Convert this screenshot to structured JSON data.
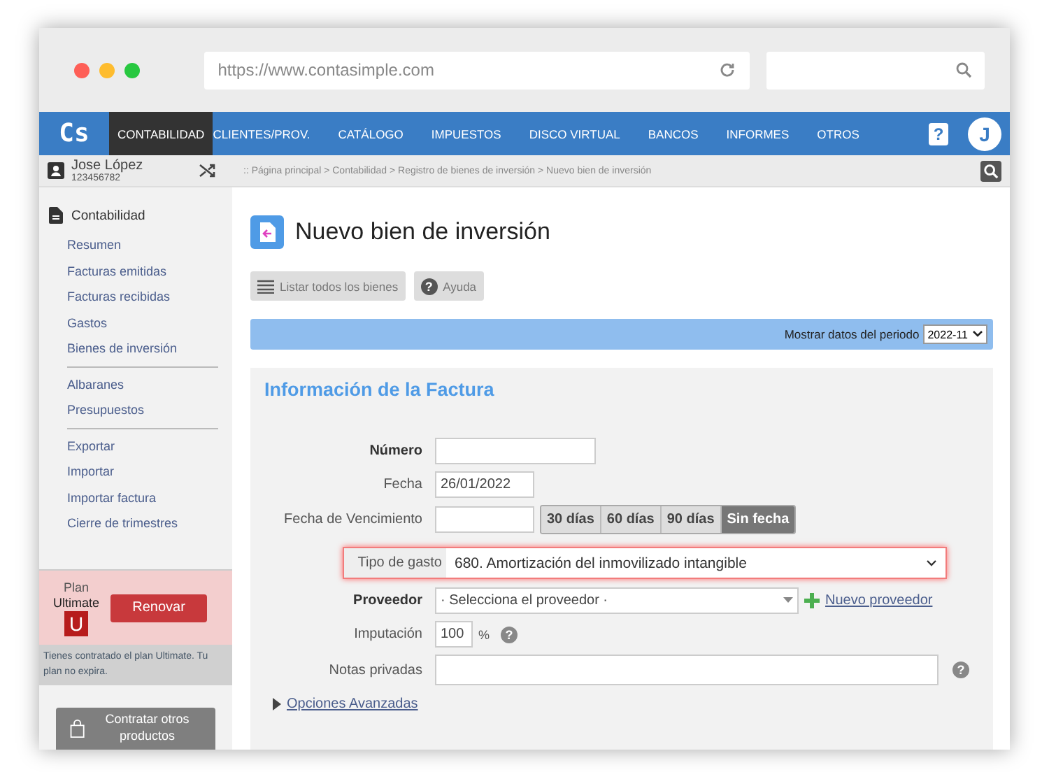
{
  "browser": {
    "url": "https://www.contasimple.com"
  },
  "nav": {
    "logo": "Cs",
    "items": [
      {
        "label": "CONTABILIDAD",
        "selected": true
      },
      {
        "label": "CLIENTES/PROV.",
        "selected": false
      },
      {
        "label": "CATÁLOGO",
        "selected": false
      },
      {
        "label": "IMPUESTOS",
        "selected": false
      },
      {
        "label": "DISCO VIRTUAL",
        "selected": false
      },
      {
        "label": "BANCOS",
        "selected": false
      },
      {
        "label": "INFORMES",
        "selected": false
      },
      {
        "label": "OTROS",
        "selected": false
      }
    ],
    "help": "?",
    "avatar": "J"
  },
  "user": {
    "name": "Jose López",
    "id": "123456782"
  },
  "breadcrumb": ":: Página principal > Contabilidad > Registro de bienes de inversión > Nuevo bien de inversión",
  "sidebar": {
    "section": "Contabilidad",
    "groups": [
      [
        "Resumen",
        "Facturas emitidas",
        "Facturas recibidas",
        "Gastos",
        "Bienes de inversión"
      ],
      [
        "Albaranes",
        "Presupuestos"
      ],
      [
        "Exportar",
        "Importar",
        "Importar factura",
        "Cierre de trimestres"
      ]
    ]
  },
  "plan": {
    "label": "Plan",
    "name": "Ultimate",
    "badge": "U",
    "button": "Renovar",
    "info": "Tienes contratado el plan Ultimate. Tu plan no expira.",
    "shop": "Contratar otros productos"
  },
  "page": {
    "title": "Nuevo bien de inversión",
    "actions": [
      "Listar todos los bienes",
      "Ayuda"
    ],
    "help_glyph": "?",
    "period_label": "Mostrar datos del periodo",
    "period": "2022-11"
  },
  "form": {
    "title": "Información de la Factura",
    "numero": {
      "label": "Número"
    },
    "fecha": {
      "label": "Fecha",
      "value": "26/01/2022"
    },
    "vencimiento": {
      "label": "Fecha de Vencimiento",
      "options": [
        {
          "label": "30 días",
          "selected": false
        },
        {
          "label": "60 días",
          "selected": false
        },
        {
          "label": "90 días",
          "selected": false
        },
        {
          "label": "Sin fecha",
          "selected": true
        }
      ]
    },
    "tipo": {
      "label": "Tipo de gasto",
      "value": "680. Amortización del inmovilizado intangible",
      "highlighted": true
    },
    "proveedor": {
      "label": "Proveedor",
      "value": "· Selecciona el proveedor ·",
      "link": "Nuevo proveedor"
    },
    "imputacion": {
      "label": "Imputación",
      "value": "100",
      "unit": "%",
      "help": "?"
    },
    "notas": {
      "label": "Notas privadas",
      "help": "?"
    },
    "advanced": "Opciones Avanzadas"
  }
}
